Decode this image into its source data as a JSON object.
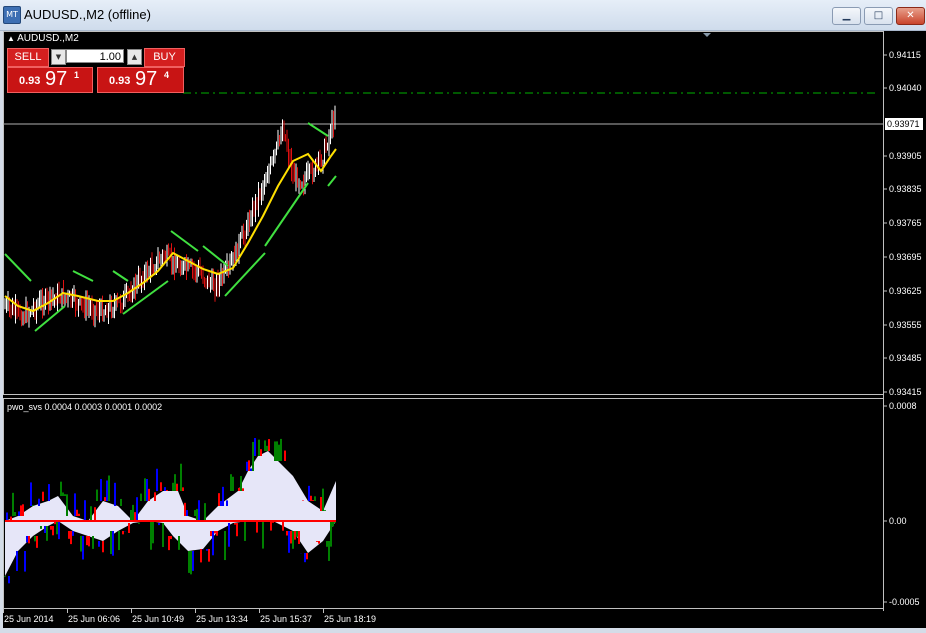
{
  "window": {
    "title": "AUDUSD.,M2 (offline)",
    "app_icon_text": "MT",
    "minimize_glyph": "▁",
    "maximize_glyph": "□",
    "close_glyph": "✕"
  },
  "chart": {
    "symbol_label": "AUDUSD.,M2",
    "background": "#000000",
    "current_price_label": "0.93971",
    "price_axis": [
      "0.94115",
      "0.94040",
      "0.93971",
      "0.93905",
      "0.93835",
      "0.93765",
      "0.93695",
      "0.93625",
      "0.93555",
      "0.93485",
      "0.93415"
    ],
    "time_axis": [
      "25 Jun 2014",
      "25 Jun 06:06",
      "25 Jun 10:49",
      "25 Jun 13:34",
      "25 Jun 15:37",
      "25 Jun 18:19"
    ]
  },
  "trade_panel": {
    "sell_label": "SELL",
    "buy_label": "BUY",
    "lot_value": "1.00",
    "spin_down": "▼",
    "spin_up": "▲",
    "sell_price": {
      "prefix": "0.93",
      "big": "97",
      "sup": "1"
    },
    "buy_price": {
      "prefix": "0.93",
      "big": "97",
      "sup": "4"
    }
  },
  "indicator": {
    "label": "pwo_svs 0.0004 0.0003 0.0001 0.0002",
    "axis": [
      "0.0008",
      "0.00",
      "-0.0005"
    ]
  },
  "colors": {
    "bull_candle": "#ffffff",
    "bear_candle": "#e01010",
    "moving_average": "#ffe000",
    "band": "#40e040",
    "histogram_positive_fill": "#e6e6f8",
    "histogram_red": "#ff0000",
    "histogram_blue": "#0000ff",
    "histogram_green": "#008000",
    "grid_dash": "#00b000"
  }
}
